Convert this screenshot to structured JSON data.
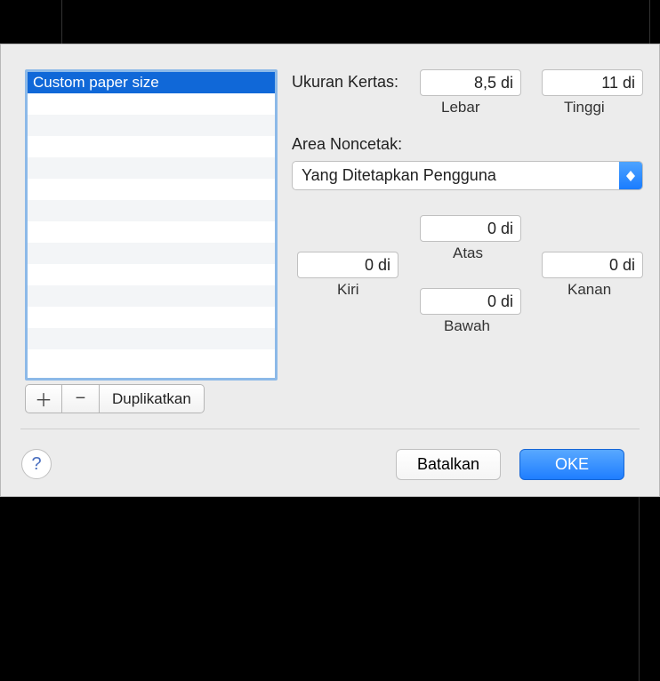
{
  "list": {
    "selected_item": "Custom paper size"
  },
  "buttons": {
    "add": "＋",
    "remove": "−",
    "duplicate": "Duplikatkan",
    "cancel": "Batalkan",
    "ok": "OKE",
    "help": "?"
  },
  "paper_size": {
    "label": "Ukuran Kertas:",
    "width_value": "8,5 di",
    "width_label": "Lebar",
    "height_value": "11 di",
    "height_label": "Tinggi"
  },
  "nonprint": {
    "label": "Area Noncetak:",
    "select_value": "Yang Ditetapkan Pengguna"
  },
  "margins": {
    "top_value": "0 di",
    "top_label": "Atas",
    "left_value": "0 di",
    "left_label": "Kiri",
    "right_value": "0 di",
    "right_label": "Kanan",
    "bottom_value": "0 di",
    "bottom_label": "Bawah"
  }
}
